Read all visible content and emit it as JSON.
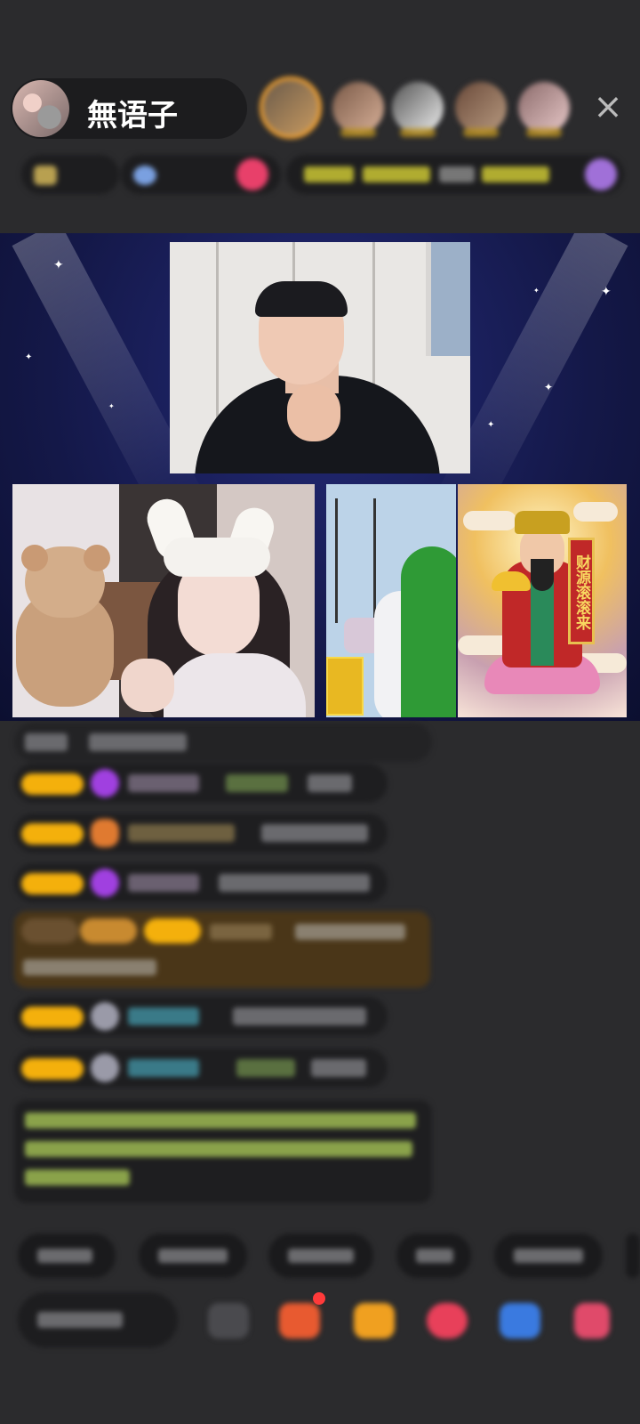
{
  "header": {
    "host_name": "無语子",
    "close_icon": "close-icon",
    "colors": {
      "top_viewer_ring": "#f0a030",
      "rank_text": "#d8d238"
    }
  },
  "stage": {
    "scroll_text": "财源滚滚来",
    "colors": {
      "background": "#141848",
      "accent": "#c02828"
    }
  },
  "chat": {
    "level_badge_color": "#f4b00c",
    "notice_text_color": "#8aa24a"
  },
  "bottom_bar": {
    "icons": [
      "emoji-icon",
      "gift-box-icon",
      "treasure-icon",
      "red-packet-icon",
      "game-icon",
      "more-icon"
    ],
    "badge_color": "#ff3a3a"
  }
}
